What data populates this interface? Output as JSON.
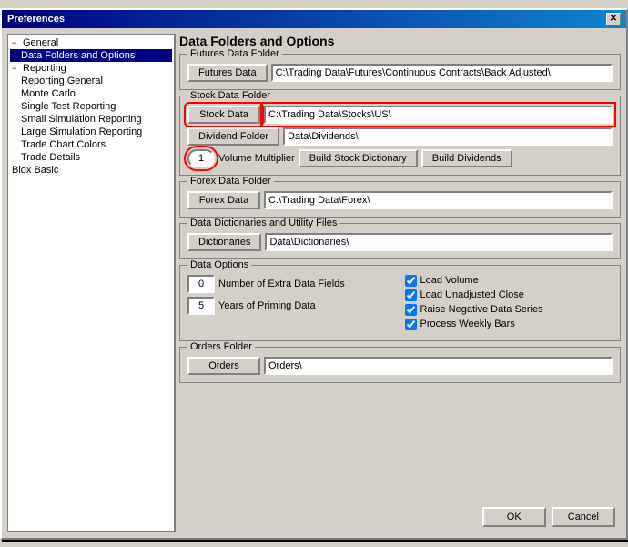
{
  "dialog": {
    "title": "Preferences",
    "close_label": "✕"
  },
  "sidebar": {
    "items": [
      {
        "id": "general",
        "label": "General",
        "level": 0,
        "expand": "−"
      },
      {
        "id": "data-folders",
        "label": "Data Folders and Options",
        "level": 1,
        "selected": true
      },
      {
        "id": "reporting",
        "label": "Reporting",
        "level": 0,
        "expand": "−"
      },
      {
        "id": "reporting-general",
        "label": "Reporting General",
        "level": 1
      },
      {
        "id": "monte-carlo",
        "label": "Monte Carlo",
        "level": 1
      },
      {
        "id": "single-test",
        "label": "Single Test Reporting",
        "level": 1
      },
      {
        "id": "small-sim",
        "label": "Small Simulation Reporting",
        "level": 1
      },
      {
        "id": "large-sim",
        "label": "Large Simulation Reporting",
        "level": 1
      },
      {
        "id": "trade-colors",
        "label": "Trade Chart Colors",
        "level": 1
      },
      {
        "id": "trade-details",
        "label": "Trade Details",
        "level": 1
      },
      {
        "id": "blox-basic",
        "label": "Blox Basic",
        "level": 0
      }
    ]
  },
  "content": {
    "title": "Data Folders and Options",
    "futures_group": {
      "label": "Futures Data Folder",
      "button": "Futures Data",
      "path": "C:\\Trading Data\\Futures\\Continuous Contracts\\Back Adjusted\\"
    },
    "stock_group": {
      "label": "Stock Data Folder",
      "stock_button": "Stock Data",
      "stock_path": "C:\\Trading Data\\Stocks\\US\\",
      "dividend_button": "Dividend Folder",
      "dividend_path": "Data\\Dividends\\",
      "volume_value": "1",
      "volume_label": "Volume Multiplier",
      "build_stock_button": "Build Stock Dictionary",
      "build_dividends_button": "Build Dividends"
    },
    "forex_group": {
      "label": "Forex Data Folder",
      "button": "Forex Data",
      "path": "C:\\Trading Data\\Forex\\"
    },
    "dictionaries_group": {
      "label": "Data Dictionaries and Utility Files",
      "button": "Dictionaries",
      "path": "Data\\Dictionaries\\"
    },
    "data_options_group": {
      "label": "Data Options",
      "extra_fields_value": "0",
      "extra_fields_label": "Number of Extra Data Fields",
      "priming_value": "5",
      "priming_label": "Years of Priming Data",
      "checkboxes": [
        {
          "id": "load-volume",
          "label": "Load Volume",
          "checked": true
        },
        {
          "id": "load-unadjusted",
          "label": "Load Unadjusted Close",
          "checked": true
        },
        {
          "id": "raise-negative",
          "label": "Raise Negative Data Series",
          "checked": true
        },
        {
          "id": "process-weekly",
          "label": "Process Weekly Bars",
          "checked": true
        }
      ]
    },
    "orders_group": {
      "label": "Orders Folder",
      "button": "Orders",
      "path": "Orders\\"
    }
  },
  "buttons": {
    "ok": "OK",
    "cancel": "Cancel"
  }
}
